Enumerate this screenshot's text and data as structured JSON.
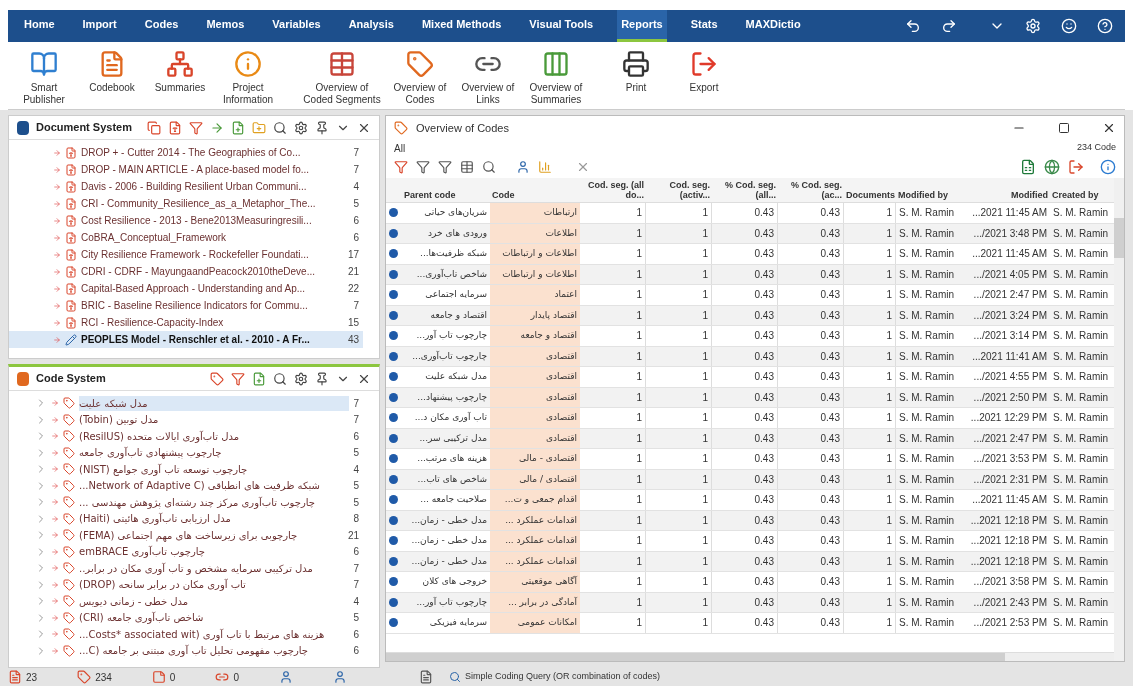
{
  "menu": {
    "tabs": [
      {
        "label": "Home",
        "selected": false
      },
      {
        "label": "Import",
        "selected": false
      },
      {
        "label": "Codes",
        "selected": false
      },
      {
        "label": "Memos",
        "selected": false
      },
      {
        "label": "Variables",
        "selected": false
      },
      {
        "label": "Analysis",
        "selected": false
      },
      {
        "label": "Mixed Methods",
        "selected": false
      },
      {
        "label": "Visual Tools",
        "selected": false
      },
      {
        "label": "Reports",
        "selected": true
      },
      {
        "label": "Stats",
        "selected": false
      },
      {
        "label": "MAXDictio",
        "selected": false
      }
    ]
  },
  "ribbon": {
    "buttons": [
      {
        "kind": "book",
        "label": "Smart Publisher"
      },
      {
        "kind": "codebook",
        "label": "Codebook"
      },
      {
        "kind": "summaries",
        "label": "Summaries"
      },
      {
        "kind": "project",
        "label": "Project Information"
      },
      {
        "kind": "segments",
        "label": "Overview of Coded Segments"
      },
      {
        "kind": "codes",
        "label": "Overview of Codes"
      },
      {
        "kind": "links",
        "label": "Overview of Links"
      },
      {
        "kind": "sumtable",
        "label": "Overview of Summaries"
      },
      {
        "kind": "print",
        "label": "Print"
      },
      {
        "kind": "export",
        "label": "Export"
      }
    ]
  },
  "document_system": {
    "title": "Document System",
    "items": [
      {
        "kind": "pdf",
        "label": "DROP +  -  Cutter 2014 - The Geographies of Co...",
        "count": "7",
        "selected": false
      },
      {
        "kind": "pdf",
        "label": "DROP - MAIN ARTICLE - A place-based model fo...",
        "count": "7",
        "selected": false
      },
      {
        "kind": "pdf",
        "label": "Davis - 2006 - Building Resilient Urban Communi...",
        "count": "4",
        "selected": false
      },
      {
        "kind": "pdf",
        "label": "CRI - Community_Resilience_as_a_Metaphor_The...",
        "count": "5",
        "selected": false
      },
      {
        "kind": "pdf",
        "label": "Cost Resilience - 2013 - Bene2013Measuringresili...",
        "count": "6",
        "selected": false
      },
      {
        "kind": "pdf",
        "label": "CoBRA_Conceptual_Framework",
        "count": "6",
        "selected": false
      },
      {
        "kind": "pdf",
        "label": "City Resilience Framework - Rockefeller Foundati...",
        "count": "17",
        "selected": false
      },
      {
        "kind": "pdf",
        "label": "CDRI - CDRF - MayungaandPeacock2010theDeve...",
        "count": "21",
        "selected": false
      },
      {
        "kind": "pdf",
        "label": "Capital-Based Approach - Understanding and Ap...",
        "count": "22",
        "selected": false
      },
      {
        "kind": "pdf",
        "label": "BRIC - Baseline Resilience Indicators for Commu...",
        "count": "7",
        "selected": false
      },
      {
        "kind": "pdf",
        "label": "RCI - Resilience-Capacity-Index",
        "count": "15",
        "selected": false
      },
      {
        "kind": "text",
        "label": "PEOPLES Model - Renschler et al. - 2010 - A Fr...",
        "count": "43",
        "selected": true
      }
    ]
  },
  "code_system": {
    "title": "Code System",
    "items": [
      {
        "label": "مدل شبکه علیت",
        "count": "7",
        "selected": true
      },
      {
        "label": "مدل توبین (Tobin)",
        "count": "7",
        "selected": false
      },
      {
        "label": "مدل تاب‌آوری ایالات متحده (ResilUS)",
        "count": "6",
        "selected": false
      },
      {
        "label": "چارچوب پیشنهادی تاب‌آوری جامعه",
        "count": "5",
        "selected": false
      },
      {
        "label": "چارچوب توسعه تاب آوری جوامع (NIST)",
        "count": "4",
        "selected": false
      },
      {
        "label": "شبکه ظرفیت های انطباقی (Network of Adaptive C...",
        "count": "5",
        "selected": false
      },
      {
        "label": "چارچوب تاب‌آوری مرکز چند رشته‌ای پژوهش مهندسی ...",
        "count": "5",
        "selected": false
      },
      {
        "label": "مدل ارزیابی تاب‌آوری هائیتی (Haiti)",
        "count": "8",
        "selected": false
      },
      {
        "label": "چارچوبی برای زیرساخت های مهم اجتماعی (FEMA)",
        "count": "21",
        "selected": false
      },
      {
        "label": "چارچوب تاب‌آوری emBRACE",
        "count": "6",
        "selected": false
      },
      {
        "label": "مدل ترکیبی سرمایه مشخص و تاب آوری مکان در برابر..",
        "count": "7",
        "selected": false
      },
      {
        "label": "تاب آوری مکان در برابر سانحه (DROP)",
        "count": "7",
        "selected": false
      },
      {
        "label": "مدل خطی - زمانی دیویس",
        "count": "4",
        "selected": false
      },
      {
        "label": "شاخص تاب‌آوری جامعه (CRI)",
        "count": "5",
        "selected": false
      },
      {
        "label": "هزینه های مرتبط با تاب آوری (Costs* associated wit...",
        "count": "6",
        "selected": false
      },
      {
        "label": "چارچوب مفهومی تحلیل تاب آوری مبتنی بر جامعه (C...",
        "count": "6",
        "selected": false
      }
    ]
  },
  "overview": {
    "title": "Overview of Codes",
    "filter": "All",
    "total": "234 Code",
    "columns": [
      "Parent code",
      "Code",
      "Cod. seg. (all do...",
      "Cod. seg. (activ...",
      "% Cod. seg. (all...",
      "% Cod. seg. (ac...",
      "Documents",
      "Modified by",
      "Modified",
      "Created by"
    ],
    "rows": [
      [
        "شریان‌های حیاتی",
        "ارتباطات",
        "1",
        "1",
        "0.43",
        "0.43",
        "1",
        "S. M. Ramin",
        "...2021 11:45 AM",
        "S. M. Ramin"
      ],
      [
        "ورودی های خرد",
        "اطلاعات",
        "1",
        "1",
        "0.43",
        "0.43",
        "1",
        "S. M. Ramin",
        ".../2021 3:48 PM",
        "S. M. Ramin"
      ],
      [
        "شبکه ظرفیت‌ها...",
        "اطلاعات و ارتباطات",
        "1",
        "1",
        "0.43",
        "0.43",
        "1",
        "S. M. Ramin",
        "...2021 11:45 AM",
        "S. M. Ramin"
      ],
      [
        "شاخص تاب‌آوری...",
        "اطلاعات و ارتباطات",
        "1",
        "1",
        "0.43",
        "0.43",
        "1",
        "S. M. Ramin",
        ".../2021 4:05 PM",
        "S. M. Ramin"
      ],
      [
        "سرمایه اجتماعی",
        "اعتماد",
        "1",
        "1",
        "0.43",
        "0.43",
        "1",
        "S. M. Ramin",
        ".../2021 2:47 PM",
        "S. M. Ramin"
      ],
      [
        "اقتصاد و جامعه",
        "اقتصاد پایدار",
        "1",
        "1",
        "0.43",
        "0.43",
        "1",
        "S. M. Ramin",
        ".../2021 3:24 PM",
        "S. M. Ramin"
      ],
      [
        "چارچوب تاب آور...",
        "اقتصاد و جامعه",
        "1",
        "1",
        "0.43",
        "0.43",
        "1",
        "S. M. Ramin",
        ".../2021 3:14 PM",
        "S. M. Ramin"
      ],
      [
        "چارچوب تاب‌آوری...",
        "اقتصادی",
        "1",
        "1",
        "0.43",
        "0.43",
        "1",
        "S. M. Ramin",
        "...2021 11:41 AM",
        "S. M. Ramin"
      ],
      [
        "مدل شبکه علیت",
        "اقتصادی",
        "1",
        "1",
        "0.43",
        "0.43",
        "1",
        "S. M. Ramin",
        ".../2021 4:55 PM",
        "S. M. Ramin"
      ],
      [
        "چارچوب پیشنهاد...",
        "اقتصادی",
        "1",
        "1",
        "0.43",
        "0.43",
        "1",
        "S. M. Ramin",
        ".../2021 2:50 PM",
        "S. M. Ramin"
      ],
      [
        "تاب آوری مکان د...",
        "اقتصادی",
        "1",
        "1",
        "0.43",
        "0.43",
        "1",
        "S. M. Ramin",
        "...2021 12:29 PM",
        "S. M. Ramin"
      ],
      [
        "مدل ترکیبی سر...",
        "اقتصادی",
        "1",
        "1",
        "0.43",
        "0.43",
        "1",
        "S. M. Ramin",
        ".../2021 2:47 PM",
        "S. M. Ramin"
      ],
      [
        "هزینه های مرتب...",
        "اقتصادی - مالی",
        "1",
        "1",
        "0.43",
        "0.43",
        "1",
        "S. M. Ramin",
        ".../2021 3:53 PM",
        "S. M. Ramin"
      ],
      [
        "شاخص های تاب...",
        "اقتصادی / مالی",
        "1",
        "1",
        "0.43",
        "0.43",
        "1",
        "S. M. Ramin",
        ".../2021 2:31 PM",
        "S. M. Ramin"
      ],
      [
        "صلاحیت جامعه ...",
        "اقدام جمعی و ت...",
        "1",
        "1",
        "0.43",
        "0.43",
        "1",
        "S. M. Ramin",
        "...2021 11:45 AM",
        "S. M. Ramin"
      ],
      [
        "مدل خطی - زمان...",
        "اقدامات عملکرد ...",
        "1",
        "1",
        "0.43",
        "0.43",
        "1",
        "S. M. Ramin",
        "...2021 12:18 PM",
        "S. M. Ramin"
      ],
      [
        "مدل خطی - زمان...",
        "اقدامات عملکرد ...",
        "1",
        "1",
        "0.43",
        "0.43",
        "1",
        "S. M. Ramin",
        "...2021 12:18 PM",
        "S. M. Ramin"
      ],
      [
        "مدل خطی - زمان...",
        "اقدامات عملکرد ...",
        "1",
        "1",
        "0.43",
        "0.43",
        "1",
        "S. M. Ramin",
        "...2021 12:18 PM",
        "S. M. Ramin"
      ],
      [
        "خروجی های کلان",
        "آگاهی موقعیتی",
        "1",
        "1",
        "0.43",
        "0.43",
        "1",
        "S. M. Ramin",
        ".../2021 3:58 PM",
        "S. M. Ramin"
      ],
      [
        "چارچوب تاب آور...",
        "آمادگی در برابر ...",
        "1",
        "1",
        "0.43",
        "0.43",
        "1",
        "S. M. Ramin",
        ".../2021 2:43 PM",
        "S. M. Ramin"
      ],
      [
        "سرمایه فیزیکی",
        "امکانات عمومی",
        "1",
        "1",
        "0.43",
        "0.43",
        "1",
        "S. M. Ramin",
        ".../2021 2:53 PM",
        "S. M. Ramin"
      ]
    ]
  },
  "status_bar": {
    "counts": [
      {
        "kind": "documents",
        "value": "23"
      },
      {
        "kind": "codes",
        "value": "234"
      },
      {
        "kind": "memos",
        "value": "0"
      },
      {
        "kind": "links",
        "value": "0"
      }
    ],
    "query": "Simple Coding Query (OR combination of codes)"
  }
}
